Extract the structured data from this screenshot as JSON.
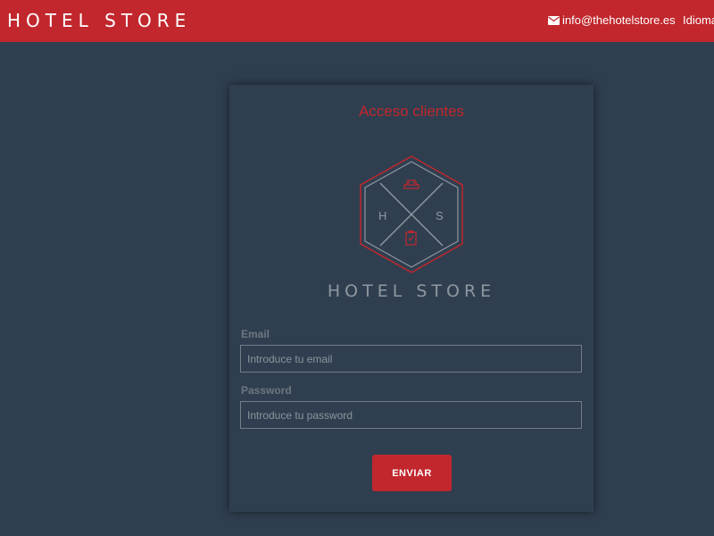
{
  "header": {
    "brand": "HOTEL STORE",
    "email": "info@thehotelstore.es",
    "language": "Idioma",
    "mail_icon": "envelope-icon",
    "background_color": "#c1272d"
  },
  "login_card": {
    "title": "Acceso clientes",
    "logo": {
      "icon": "hotel-store-hexagon-logo",
      "letter_left": "H",
      "letter_right": "S",
      "text": "HOTEL STORE"
    },
    "email_label": "Email",
    "email_placeholder": "Introduce tu email",
    "email_value": "",
    "password_label": "Password",
    "password_placeholder": "Introduce tu password",
    "password_value": "",
    "submit_label": "ENVIAR"
  },
  "colors": {
    "accent": "#c1272d",
    "background": "#2f3f50",
    "logo_gray": "#8f979f"
  }
}
